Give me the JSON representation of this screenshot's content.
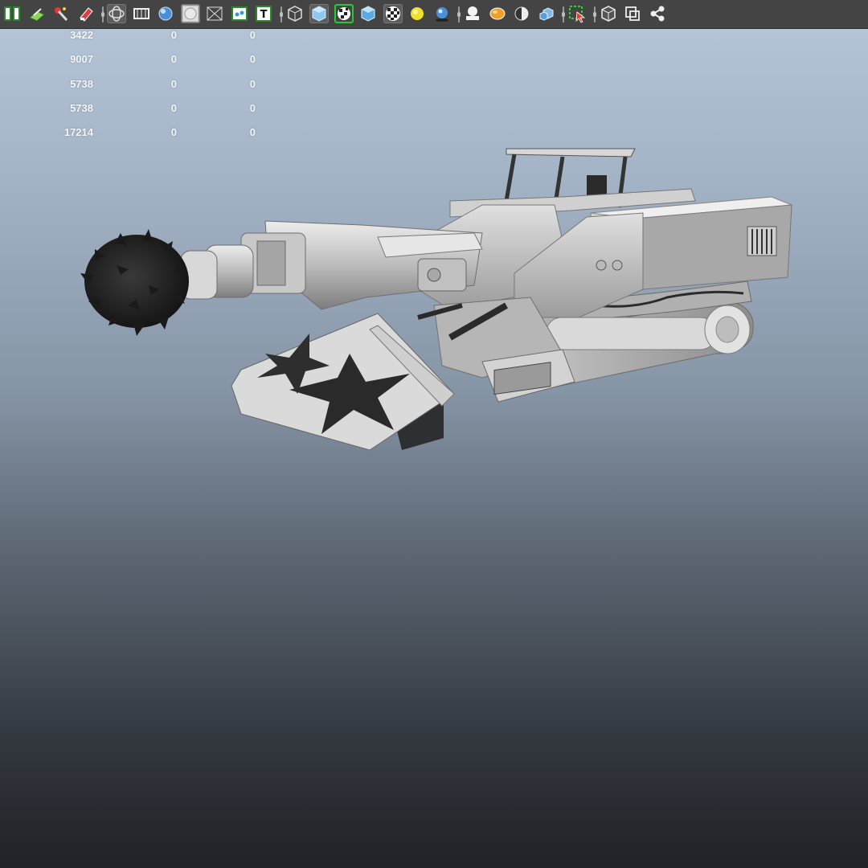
{
  "app": {
    "accent_selected": "#22cc33",
    "toolbar_bg": "#444444"
  },
  "toolbar": {
    "groups": [
      [
        "open-file-icon",
        "snap-to-grid-icon",
        "paint-effects-icon",
        "eraser-brush-icon"
      ],
      [
        "wireframe-cube-icon",
        "film-gate-icon",
        "shaded-sphere-icon",
        "hollow-sphere-icon",
        "xray-grid-icon",
        "smooth-shade-icon",
        "text-label-icon"
      ],
      [
        "wire-cube-icon",
        "shaded-cube-icon",
        "textured-checker-icon",
        "default-material-icon",
        "checker-texture-icon",
        "use-lights-icon",
        "shadows-icon"
      ],
      [
        "ambient-light-icon",
        "high-quality-icon",
        "half-lit-sphere-icon",
        "multi-cube-icon"
      ],
      [
        "isolate-select-icon"
      ],
      [
        "bounding-box-icon",
        "frame-all-icon",
        "share-nodes-icon"
      ]
    ]
  },
  "hud": {
    "rows": [
      {
        "c1": "3422",
        "c2": "0",
        "c3": "0"
      },
      {
        "c1": "9007",
        "c2": "0",
        "c3": "0"
      },
      {
        "c1": "5738",
        "c2": "0",
        "c3": "0"
      },
      {
        "c1": "5738",
        "c2": "0",
        "c3": "0"
      },
      {
        "c1": "17214",
        "c2": "0",
        "c3": "0"
      }
    ]
  },
  "viewport": {
    "background_top": "#b7c7d9",
    "background_bottom": "#1f2226",
    "model": "road-header-mining-machine",
    "model_color": "#c9c9c9"
  }
}
